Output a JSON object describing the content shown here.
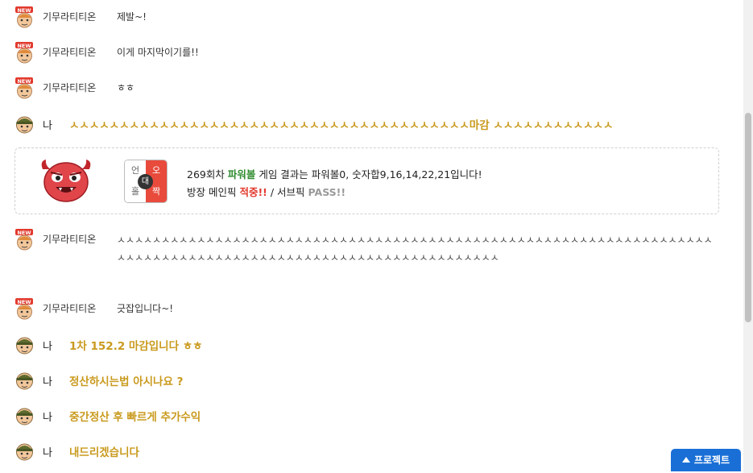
{
  "messages": [
    {
      "type": "other",
      "name": "기무라티티온",
      "text": "제발~!"
    },
    {
      "type": "other",
      "name": "기무라티티온",
      "text": "이게 마지막이기를!!"
    },
    {
      "type": "other",
      "name": "기무라티티온",
      "text": "ㅎㅎ"
    },
    {
      "type": "me",
      "name": "나",
      "text": "ㅅㅅㅅㅅㅅㅅㅅㅅㅅㅅㅅㅅㅅㅅㅅㅅㅅㅅㅅㅅㅅㅅㅅㅅㅅㅅㅅㅅㅅㅅㅅㅅㅅㅅㅅㅅㅅㅅㅅㅅ마감 ㅅㅅㅅㅅㅅㅅㅅㅅㅅㅅㅅㅅ"
    },
    {
      "type": "other",
      "name": "기무라티티온",
      "text": "ㅅㅅㅅㅅㅅㅅㅅㅅㅅㅅㅅㅅㅅㅅㅅㅅㅅㅅㅅㅅㅅㅅㅅㅅㅅㅅㅅㅅㅅㅅㅅㅅㅅㅅㅅㅅㅅㅅㅅㅅㅅㅅㅅㅅㅅㅅㅅㅅㅅㅅㅅㅅㅅㅅㅅㅅㅅㅅㅅㅅㅅㅅㅅㅅㅅㅅㅅㅅㅅㅅㅅㅅㅅㅅㅅㅅㅅㅅㅅㅅㅅㅅㅅㅅㅅㅅㅅㅅㅅㅅㅅㅅㅅㅅㅅㅅㅅㅅㅅㅅㅅㅅㅅㅅㅅㅅㅅㅅㅅㅅ"
    },
    {
      "type": "other",
      "name": "기무라티티온",
      "text": "긋잡입니다~!"
    },
    {
      "type": "me",
      "name": "나",
      "text": "1차 152.2 마감입니다 ㅎㅎ"
    },
    {
      "type": "me",
      "name": "나",
      "text": "정산하시는법 아시나요 ?"
    },
    {
      "type": "me",
      "name": "나",
      "text": "중간정산 후 빠르게 추가수익"
    },
    {
      "type": "me",
      "name": "나",
      "text": "내드리겠습니다"
    }
  ],
  "result": {
    "badge": {
      "top_left": "언",
      "top_right": "오",
      "bottom_left": "홀",
      "bottom_right": "짝",
      "center": "대"
    },
    "line1_prefix": "269회차 ",
    "line1_game": "파워볼",
    "line1_suffix": " 게임 결과는 파워볼0, 숫자합9,16,14,22,21입니다!",
    "line2_prefix": "방장 메인픽 ",
    "line2_hit": "적중!!",
    "line2_mid": " / 서브픽 ",
    "line2_pass": "PASS!!"
  },
  "project_button": "프로젝트",
  "colors": {
    "accent": "#c99a1e",
    "button": "#1a6fd6",
    "hit": "#e23a2e",
    "game": "#2e8b2e"
  }
}
